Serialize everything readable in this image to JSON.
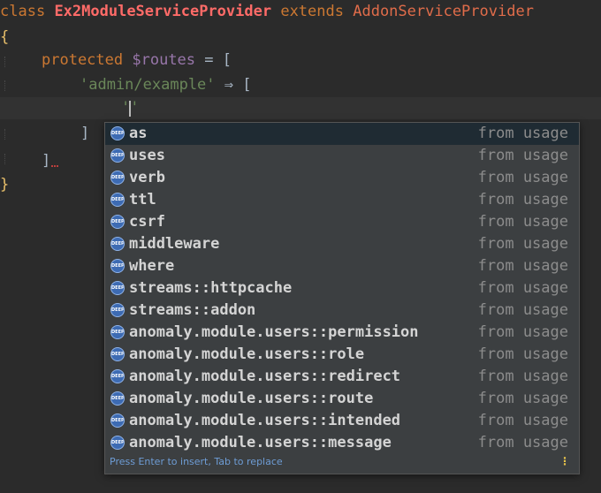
{
  "code": {
    "line1": {
      "kw": "class",
      "cls": "Ex2ModuleServiceProvider",
      "kw2": "extends",
      "parent": "AddonServiceProvider"
    },
    "line2": {
      "brace": "{"
    },
    "line3": {
      "kw": "protected",
      "var": "$routes",
      "op": "= ["
    },
    "line4": {
      "str": "'admin/example'",
      "op": "⇒ ["
    },
    "line5": {
      "str_open": "'",
      "str_close": "'"
    },
    "line6": {
      "text": "]"
    },
    "line7": {
      "text": "]"
    },
    "line8": {
      "brace": "}"
    }
  },
  "autocomplete": {
    "icon_text": "DEEP",
    "source_label": "from usage",
    "items": [
      {
        "label": "as"
      },
      {
        "label": "uses"
      },
      {
        "label": "verb"
      },
      {
        "label": "ttl"
      },
      {
        "label": "csrf"
      },
      {
        "label": "middleware"
      },
      {
        "label": "where"
      },
      {
        "label": "streams::httpcache"
      },
      {
        "label": "streams::addon"
      },
      {
        "label": "anomaly.module.users::permission"
      },
      {
        "label": "anomaly.module.users::role"
      },
      {
        "label": "anomaly.module.users::redirect"
      },
      {
        "label": "anomaly.module.users::route"
      },
      {
        "label": "anomaly.module.users::intended"
      },
      {
        "label": "anomaly.module.users::message"
      }
    ],
    "footer": "Press Enter to insert, Tab to replace",
    "more_icon": "⋮"
  },
  "colors": {
    "background": "#2b2b2b",
    "popup": "#3c3f41",
    "selected": "#1f2b33",
    "keyword": "#cc7832",
    "class_name": "#ff6b68",
    "string": "#6a8759",
    "variable": "#9876aa"
  }
}
